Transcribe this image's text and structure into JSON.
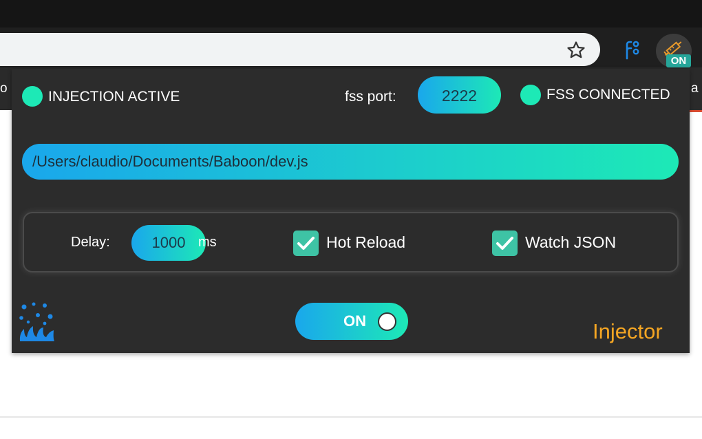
{
  "browser": {
    "extension_badge": "ON",
    "edge_text_left": "o",
    "edge_text_right": "a"
  },
  "popup": {
    "injection_status": "INJECTION ACTIVE",
    "fss_port_label": "fss port:",
    "fss_port_value": "2222",
    "fss_status": "FSS CONNECTED",
    "file_path": "/Users/claudio/Documents/Baboon/dev.js",
    "delay_label": "Delay:",
    "delay_value": "1000",
    "delay_unit": "ms",
    "hot_reload_label": "Hot Reload",
    "hot_reload_checked": true,
    "watch_json_label": "Watch JSON",
    "watch_json_checked": true,
    "toggle_label": "ON",
    "logo_text": "Injector"
  },
  "colors": {
    "status_dot": "#1de9b6",
    "gradient_start": "#1aa7ec",
    "gradient_end": "#1de9b6",
    "logo": "#f5a623",
    "checkbox": "#3ec3a5"
  },
  "icons": [
    "star-icon",
    "branch-icon",
    "syringe-icon",
    "check-icon",
    "splash-icon",
    "injector-logo"
  ]
}
